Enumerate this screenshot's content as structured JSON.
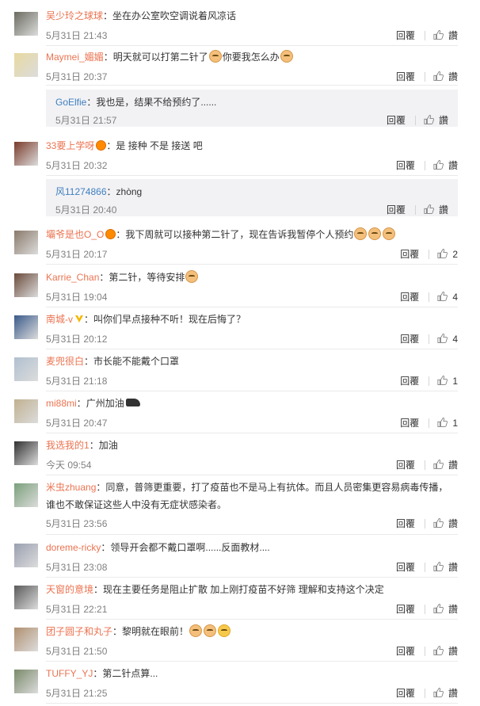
{
  "reply_label": "回覆",
  "like_label": "讚",
  "comments": [
    {
      "user": "吴少玲之球球",
      "sep": "：",
      "text": "坐在办公室吹空调说着风凉话",
      "time": "5月31日 21:43",
      "likes": "讚",
      "avatar_color": "#6b6b60"
    },
    {
      "user": "Maymei_媚媚",
      "sep": "：",
      "text": "明天就可以打第二针了",
      "text2": "你要我怎么办",
      "time": "5月31日 20:37",
      "likes": "讚",
      "avatar_color": "#e8d9a0",
      "emo1": "emoji",
      "emo2": "emoji"
    },
    {
      "user": "33要上学呀",
      "sep": "：",
      "text": "是 接种 不是 接送 吧",
      "time": "5月31日 20:32",
      "likes": "讚",
      "avatar_color": "#7a3a2a",
      "vip": true
    },
    {
      "user": "壩爷是也O_O",
      "sep": "：",
      "text": "我下周就可以接种第二针了，现在告诉我暂停个人预约",
      "time": "5月31日 20:17",
      "likes": "2",
      "avatar_color": "#8a7a6a",
      "vip": true
    },
    {
      "user": "Karrie_Chan",
      "sep": "：",
      "text": "第二针，等待安排",
      "time": "5月31日 19:04",
      "likes": "4",
      "avatar_color": "#6a4a3a"
    },
    {
      "user": "南城-v",
      "sep": "：",
      "text": "叫你们早点接种不听！现在后悔了？",
      "time": "5月31日 20:12",
      "likes": "4",
      "avatar_color": "#3a5a8a",
      "badge": true
    },
    {
      "user": "麦兜很白",
      "sep": "：",
      "text": "市长能不能戴个口罩",
      "time": "5月31日 21:18",
      "likes": "1",
      "avatar_color": "#b0c0d0"
    },
    {
      "user": "mi88mi",
      "sep": "：",
      "text": "广州加油",
      "time": "5月31日 20:47",
      "likes": "1",
      "avatar_color": "#c0b090"
    },
    {
      "user": "我选我的1",
      "sep": "：",
      "text": "加油",
      "time": "今天 09:54",
      "likes": "讚",
      "avatar_color": "#303030"
    },
    {
      "user": "米虫zhuang",
      "sep": "：",
      "text": "同意，普筛更重要，打了疫苗也不是马上有抗体。而且人员密集更容易病毒传播，谁也不敢保证这些人中没有无症状感染者。",
      "time": "5月31日 23:56",
      "likes": "讚",
      "avatar_color": "#7aa07a"
    },
    {
      "user": "doreme-ricky",
      "sep": "：",
      "text": "领导开会都不戴口罩啊......反面教材....",
      "time": "5月31日 23:08",
      "likes": "讚",
      "avatar_color": "#9aa0b0"
    },
    {
      "user": "天窗的意境",
      "sep": "：",
      "text": "现在主要任务是阻止扩散  加上刚打疫苗不好筛 理解和支持这个决定",
      "time": "5月31日 22:21",
      "likes": "讚",
      "avatar_color": "#5a5a5a"
    },
    {
      "user": "团子圆子和丸子",
      "sep": "：",
      "text": "黎明就在眼前！",
      "time": "5月31日 21:50",
      "likes": "讚",
      "avatar_color": "#b09070"
    },
    {
      "user": "TUFFY_YJ",
      "sep": "：",
      "text": "第二针点算...",
      "time": "5月31日 21:25",
      "likes": "讚",
      "avatar_color": "#7a8a6a"
    }
  ],
  "replies": [
    {
      "user": "GoElfie",
      "sep": "：",
      "text": "我也是，结果不给预约了......",
      "time": "5月31日 21:57",
      "likes": "讚"
    },
    {
      "user": "风11274866",
      "sep": "：",
      "text": "zhòng",
      "time": "5月31日 20:40",
      "likes": "讚"
    }
  ]
}
